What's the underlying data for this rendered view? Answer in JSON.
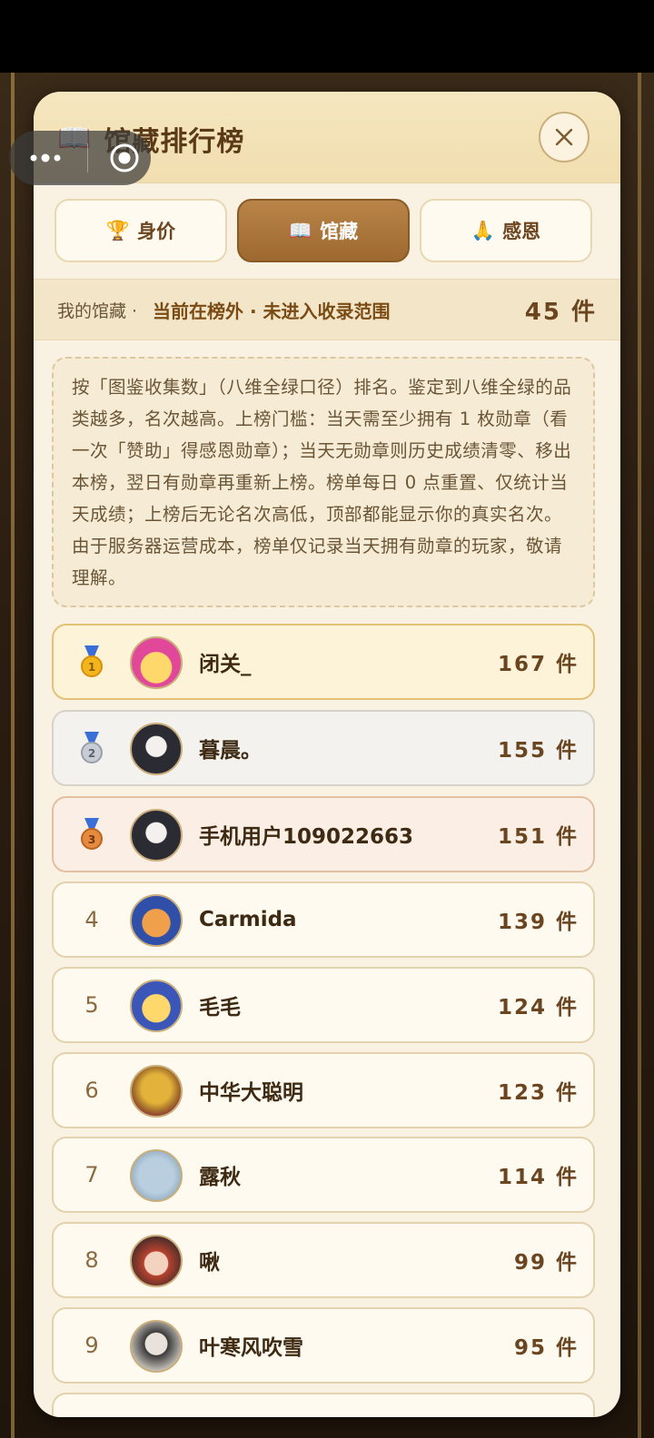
{
  "header": {
    "title": "馆藏排行榜"
  },
  "tabs": [
    {
      "emoji": "🏆",
      "label": "身价",
      "active": false
    },
    {
      "emoji": "📖",
      "label": "馆藏",
      "active": true
    },
    {
      "emoji": "🙏",
      "label": "感恩",
      "active": false
    }
  ],
  "my": {
    "label": "我的馆藏 ·",
    "status": "当前在榜外 · 未进入收录范围",
    "count": "45 件"
  },
  "notice": "按「图鉴收集数」（八维全绿口径）排名。鉴定到八维全绿的品类越多，名次越高。上榜门槛：当天需至少拥有 1 枚勋章（看一次「赞助」得感恩勋章）；当天无勋章则历史成绩清零、移出本榜，翌日有勋章再重新上榜。榜单每日 0 点重置、仅统计当天成绩；上榜后无论名次高低，顶部都能显示你的真实名次。由于服务器运营成本，榜单仅记录当天拥有勋章的玩家，敬请理解。",
  "rank_list": [
    {
      "rank": "1",
      "medal": "gold",
      "name": "闭关_",
      "count": "167 件"
    },
    {
      "rank": "2",
      "medal": "silver",
      "name": "暮晨。",
      "count": "155 件"
    },
    {
      "rank": "3",
      "medal": "bronze",
      "name": "手机用户109022663",
      "count": "151 件"
    },
    {
      "rank": "4",
      "medal": "",
      "name": "Carmida",
      "count": "139 件"
    },
    {
      "rank": "5",
      "medal": "",
      "name": "毛毛",
      "count": "124 件"
    },
    {
      "rank": "6",
      "medal": "",
      "name": "中华大聪明",
      "count": "123 件"
    },
    {
      "rank": "7",
      "medal": "",
      "name": "露秋",
      "count": "114 件"
    },
    {
      "rank": "8",
      "medal": "",
      "name": "啾",
      "count": "99 件"
    },
    {
      "rank": "9",
      "medal": "",
      "name": "叶寒风吹雪",
      "count": "95 件"
    }
  ],
  "colors": {
    "accent": "#a87137",
    "panel": "#f9f2e2",
    "gold": "#e3c277"
  }
}
